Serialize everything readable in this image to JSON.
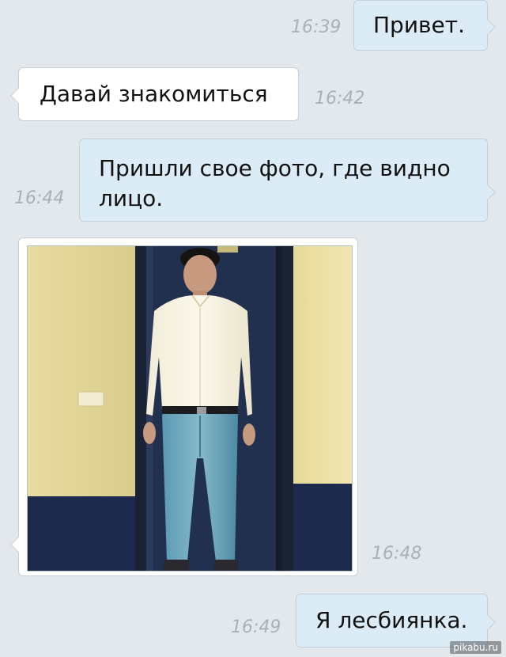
{
  "messages": [
    {
      "id": "m1",
      "direction": "outgoing",
      "text": "Привет.",
      "time": "16:39"
    },
    {
      "id": "m2",
      "direction": "incoming",
      "text": "Давай знакомиться",
      "time": "16:42"
    },
    {
      "id": "m3",
      "direction": "outgoing",
      "text": "Пришли свое фото, где видно\nлицо.",
      "time": "16:44"
    },
    {
      "id": "m4",
      "direction": "incoming",
      "type": "photo",
      "photo_subject": "man-standing-in-doorway",
      "time": "16:48"
    },
    {
      "id": "m5",
      "direction": "outgoing",
      "text": "Я лесбиянка.",
      "time": "16:49"
    }
  ],
  "watermark": "pikabu.ru",
  "colors": {
    "background": "#e3e8ec",
    "outgoing_bubble": "#dcecf6",
    "incoming_bubble": "#ffffff",
    "timestamp": "#a8b0b8"
  }
}
